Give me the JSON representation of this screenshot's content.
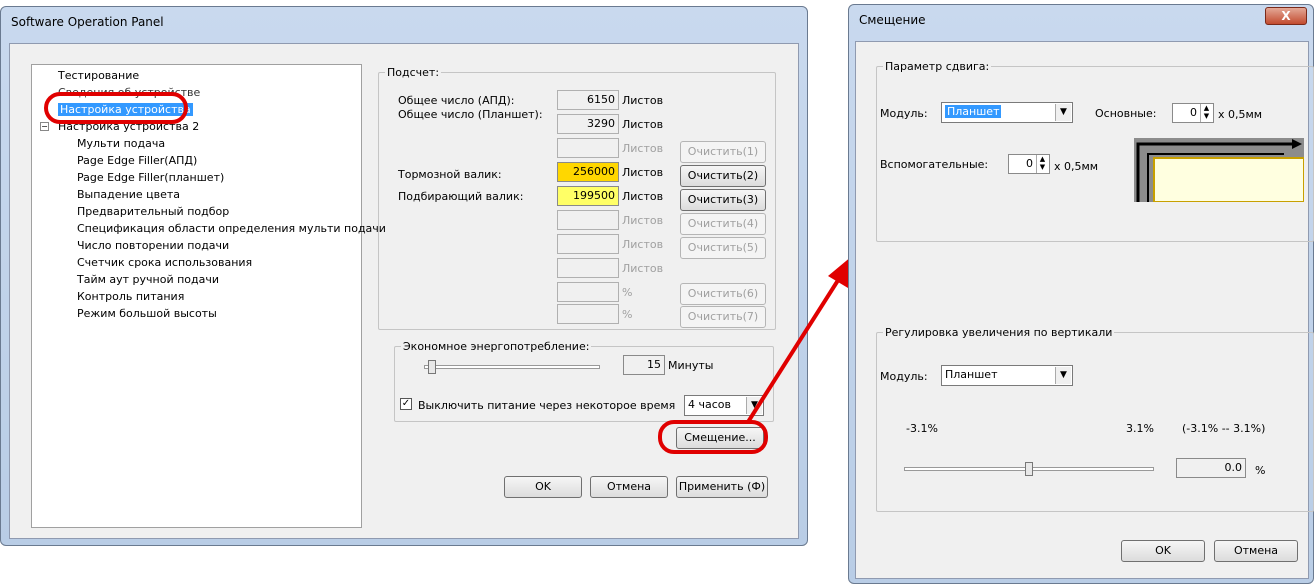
{
  "main_window": {
    "title": "Software Operation Panel",
    "tree": [
      "Тестирование",
      "Сведения об устройстве",
      "Настройка устройства",
      "Настройка устройства 2",
      "Мульти подача",
      "Page Edge Filler(АПД)",
      "Page Edge Filler(планшет)",
      "Выпадение цвета",
      "Предварительный подбор",
      "Спецификация области определения мульти подачи",
      "Число повторении подачи",
      "Счетчик срока использования",
      "Тайм аут ручной подачи",
      "Контроль питания",
      "Режим большой высоты"
    ],
    "counter": {
      "group_label": "Подсчет:",
      "total_adf_label": "Общее число (АПД):",
      "total_adf_value": "6150",
      "total_adf_unit": "Листов",
      "total_flatbed_label": "Общее число (Планшет):",
      "total_flatbed_value": "3290",
      "total_flatbed_unit": "Листов",
      "row3_unit": "Листов",
      "row3_btn": "Очистить(1)",
      "brake_label": "Тормозной валик:",
      "brake_value": "256000",
      "brake_unit": "Листов",
      "brake_btn": "Очистить(2)",
      "pick_label": "Подбирающий валик:",
      "pick_value": "199500",
      "pick_unit": "Листов",
      "pick_btn": "Очистить(3)",
      "row6_unit": "Листов",
      "row6_btn": "Очистить(4)",
      "row7_unit": "Листов",
      "row7_btn": "Очистить(5)",
      "row8_unit": "Листов",
      "row9_unit": "%",
      "row9_btn": "Очистить(6)",
      "row10_unit": "%",
      "row10_btn": "Очистить(7)"
    },
    "power": {
      "group_label": "Экономное энергопотребление:",
      "value": "15",
      "unit": "Минуты",
      "auto_off_label": "Выключить питание через некоторое время",
      "auto_off_checked": true,
      "auto_off_value": "4 часов"
    },
    "offset_btn": "Смещение...",
    "ok": "OK",
    "cancel": "Отмена",
    "apply": "Применить (Ф)"
  },
  "offset_dialog": {
    "title": "Смещение",
    "close": "X",
    "shift_group": "Параметр сдвига:",
    "module_label": "Модуль:",
    "module_value": "Планшет",
    "main_label": "Основные:",
    "main_value": "0",
    "main_unit": "x 0,5мм",
    "sub_label": "Вспомогательные:",
    "sub_value": "0",
    "sub_unit": "x 0,5мм",
    "vert_group": "Регулировка увеличения по вертикали",
    "vmodule_label": "Модуль:",
    "vmodule_value": "Планшет",
    "min": "-3.1%",
    "max": "3.1%",
    "range": "(-3.1% -- 3.1%)",
    "slider_value": "0.0",
    "slider_unit": "%",
    "slider_fraction": 0.5,
    "ok": "OK",
    "cancel": "Отмена"
  },
  "colors": {
    "highlight": "#e00000",
    "selection": "#3399ff",
    "brake_fill": "#ffd700",
    "pick_fill": "#ffff66"
  }
}
